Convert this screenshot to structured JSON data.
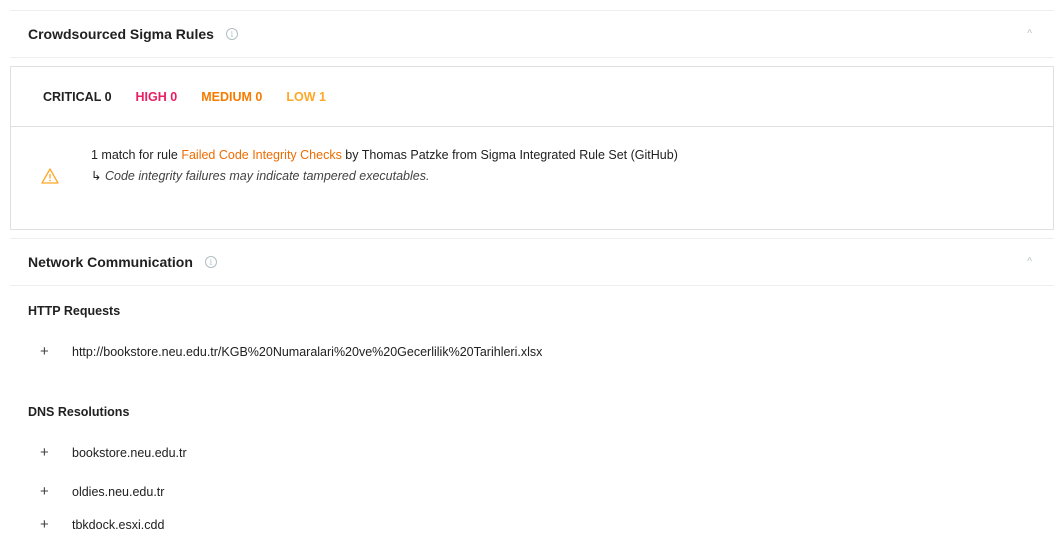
{
  "sigma": {
    "title": "Crowdsourced Sigma Rules",
    "severity": {
      "critical": "CRITICAL 0",
      "high": "HIGH 0",
      "medium": "MEDIUM 0",
      "low": "LOW 1"
    },
    "match": {
      "prefix": "1 match for rule ",
      "rule_name": "Failed Code Integrity Checks",
      "suffix": " by Thomas Patzke from Sigma Integrated Rule Set (GitHub)",
      "description": "Code integrity failures may indicate tampered executables."
    }
  },
  "network": {
    "title": "Network Communication",
    "http_heading": "HTTP Requests",
    "http_requests": [
      "http://bookstore.neu.edu.tr/KGB%20Numaralari%20ve%20Gecerlilik%20Tarihleri.xlsx"
    ],
    "dns_heading": "DNS Resolutions",
    "dns_resolutions": [
      "bookstore.neu.edu.tr",
      "oldies.neu.edu.tr",
      "tbkdock.esxi.cdd"
    ]
  },
  "icons": {
    "info": "info-icon",
    "collapse": "chevron-up-icon",
    "warning": "warning-icon",
    "expand": "plus-icon",
    "arrow": "return-arrow-icon"
  },
  "colors": {
    "high": "#e91e63",
    "medium": "#f57c00",
    "low": "#ffa726",
    "link": "#ef6c00"
  }
}
